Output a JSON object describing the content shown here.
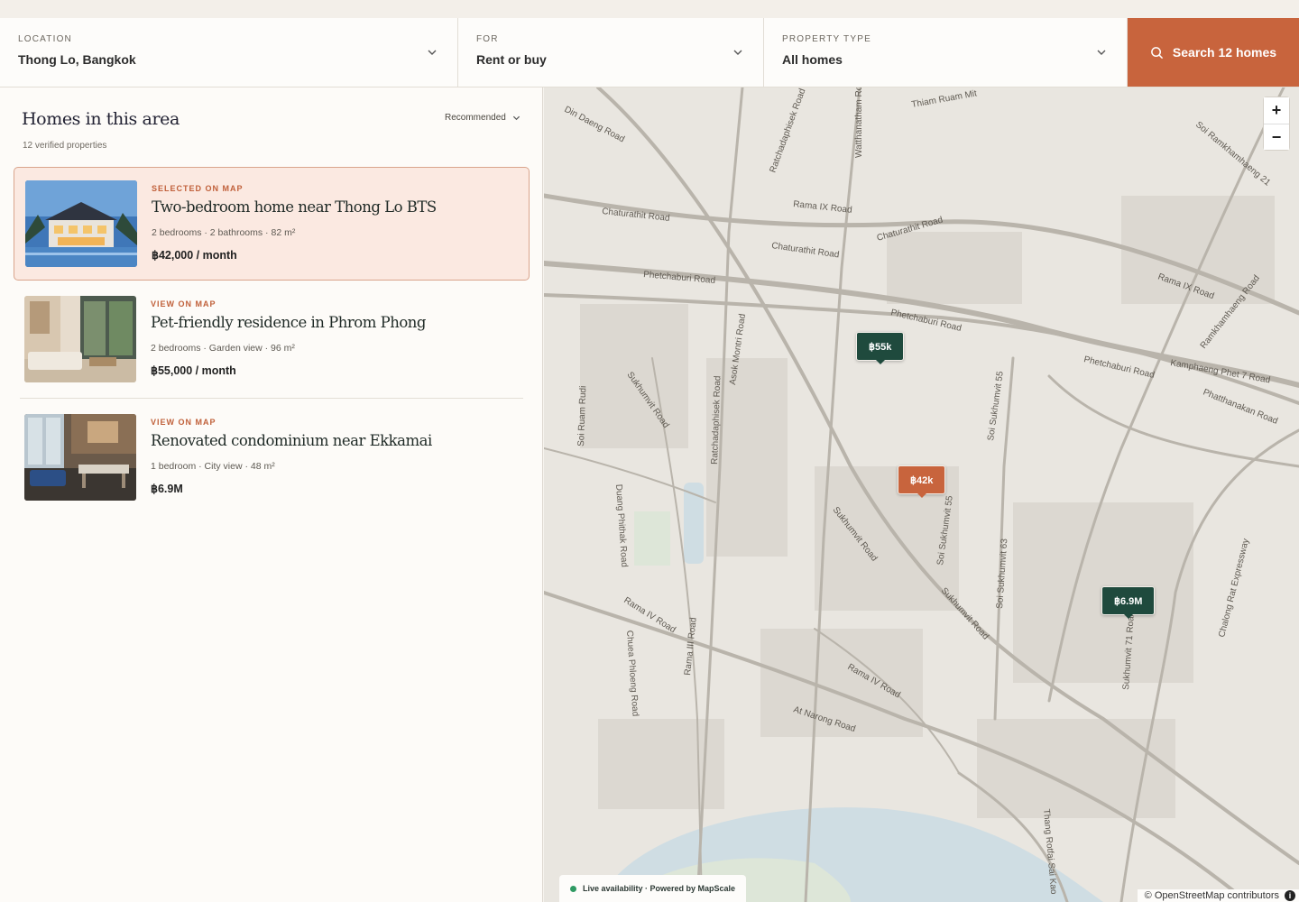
{
  "search": {
    "location": {
      "label": "LOCATION",
      "value": "Thong Lo, Bangkok"
    },
    "for": {
      "label": "FOR",
      "value": "Rent or buy"
    },
    "property_type": {
      "label": "PROPERTY TYPE",
      "value": "All homes"
    },
    "button_label": "Search 12 homes"
  },
  "listings_panel": {
    "title": "Homes in this area",
    "subtitle": "12 verified properties",
    "sort_label": "Recommended",
    "items": [
      {
        "tag": "SELECTED ON MAP",
        "title": "Two-bedroom home near Thong Lo BTS",
        "meta": "2 bedrooms · 2 bathrooms · 82 m²",
        "price": "฿42,000 / month"
      },
      {
        "tag": "VIEW ON MAP",
        "title": "Pet-friendly residence in Phrom Phong",
        "meta": "2 bedrooms · Garden view · 96 m²",
        "price": "฿55,000 / month"
      },
      {
        "tag": "VIEW ON MAP",
        "title": "Renovated condominium near Ekkamai",
        "meta": "1 bedroom · City view · 48 m²",
        "price": "฿6.9M"
      }
    ]
  },
  "map": {
    "pins": [
      "฿55k",
      "฿42k",
      "฿6.9M"
    ],
    "live_badge": "Live availability · Powered by MapScale",
    "attribution": "© OpenStreetMap contributors",
    "zoom_in": "+",
    "zoom_out": "−",
    "road_labels": [
      "Din Daeng Road",
      "Ratchadaphisek Road",
      "Watthanatham Road",
      "Thiam Ruam Mit",
      "Chaturathit Road",
      "Rama IX Road",
      "Chaturathit Road",
      "Chaturathit Road",
      "Phetchaburi Road",
      "Phetchaburi Road",
      "Phetchaburi Road",
      "Rama IX Road",
      "Ramkhamhaeng Road",
      "Soi Ramkhamhaeng 21",
      "Kamphaeng Phet 7 Road",
      "Phatthanakan Road",
      "Sukhumvit Road",
      "Asok Montri Road",
      "Soi Sukhumvit 55",
      "Soi Ruam Rudi",
      "Ratchadaphisek Road",
      "Duang Phithak Road",
      "Sukhumvit Road",
      "Soi Sukhumvit 55",
      "Soi Sukhumvit 63",
      "Sukhumvit Road",
      "Rama IV Road",
      "Rama III Road",
      "Chuea Phloeng Road",
      "Rama IV Road",
      "At Narong Road",
      "Sukhumvit 71 Road",
      "Chalong Rat Expressway",
      "Thang Rotfai Sai Kao"
    ],
    "colors": {
      "land": "#e9e6e0",
      "water": "#cfdde3",
      "park": "#dde6d8",
      "road": "#b9b4ab",
      "pin_green": "#1f4a3d",
      "pin_orange": "#c8643d"
    }
  }
}
